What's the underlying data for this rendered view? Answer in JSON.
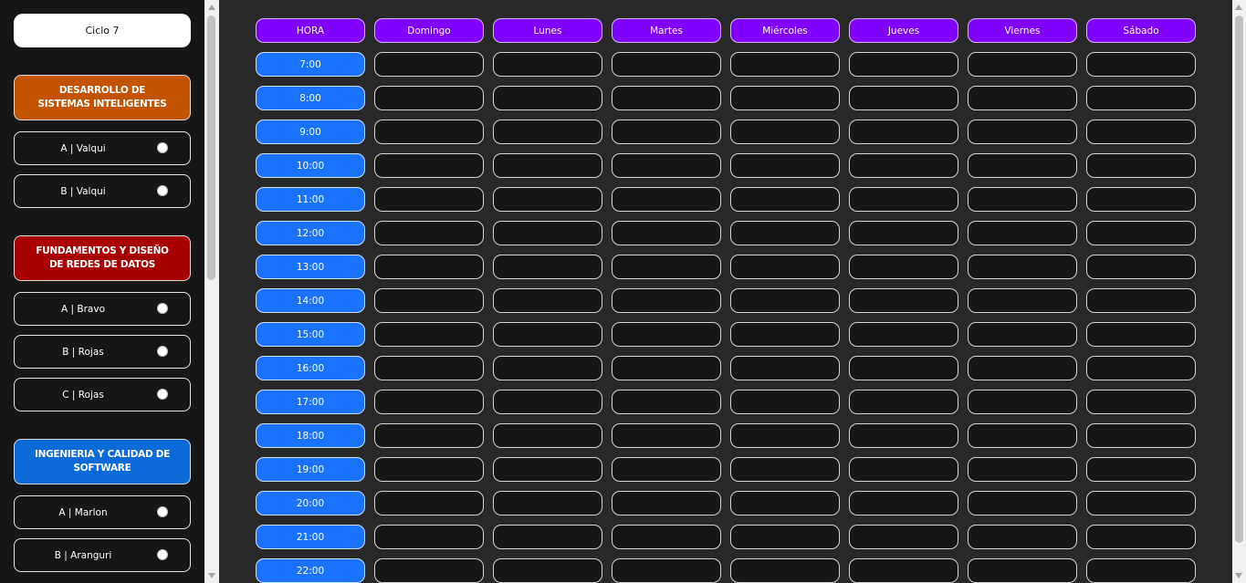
{
  "sidebar": {
    "cycle_label": "Ciclo 7",
    "courses": [
      {
        "name": "DESARROLLO DE SISTEMAS INTELIGENTES",
        "color": "#c35300",
        "sections": [
          "A | Valqui",
          "B | Valqui"
        ]
      },
      {
        "name": "FUNDAMENTOS Y DISEÑO DE REDES DE DATOS",
        "color": "#a80000",
        "sections": [
          "A | Bravo",
          "B | Rojas",
          "C | Rojas"
        ]
      },
      {
        "name": "INGENIERIA Y CALIDAD DE SOFTWARE",
        "color": "#0a6ad8",
        "sections": [
          "A | Marlon",
          "B | Aranguri"
        ]
      }
    ]
  },
  "schedule": {
    "columns": [
      "HORA",
      "Domingo",
      "Lunes",
      "Martes",
      "Miércoles",
      "Jueves",
      "Viernes",
      "Sábado"
    ],
    "hours": [
      "7:00",
      "8:00",
      "9:00",
      "10:00",
      "11:00",
      "12:00",
      "13:00",
      "14:00",
      "15:00",
      "16:00",
      "17:00",
      "18:00",
      "19:00",
      "20:00",
      "21:00",
      "22:00"
    ]
  },
  "colors": {
    "header": "#8000ff",
    "hour": "#1a73ff",
    "background": "#282828",
    "sidebar": "#161616"
  }
}
